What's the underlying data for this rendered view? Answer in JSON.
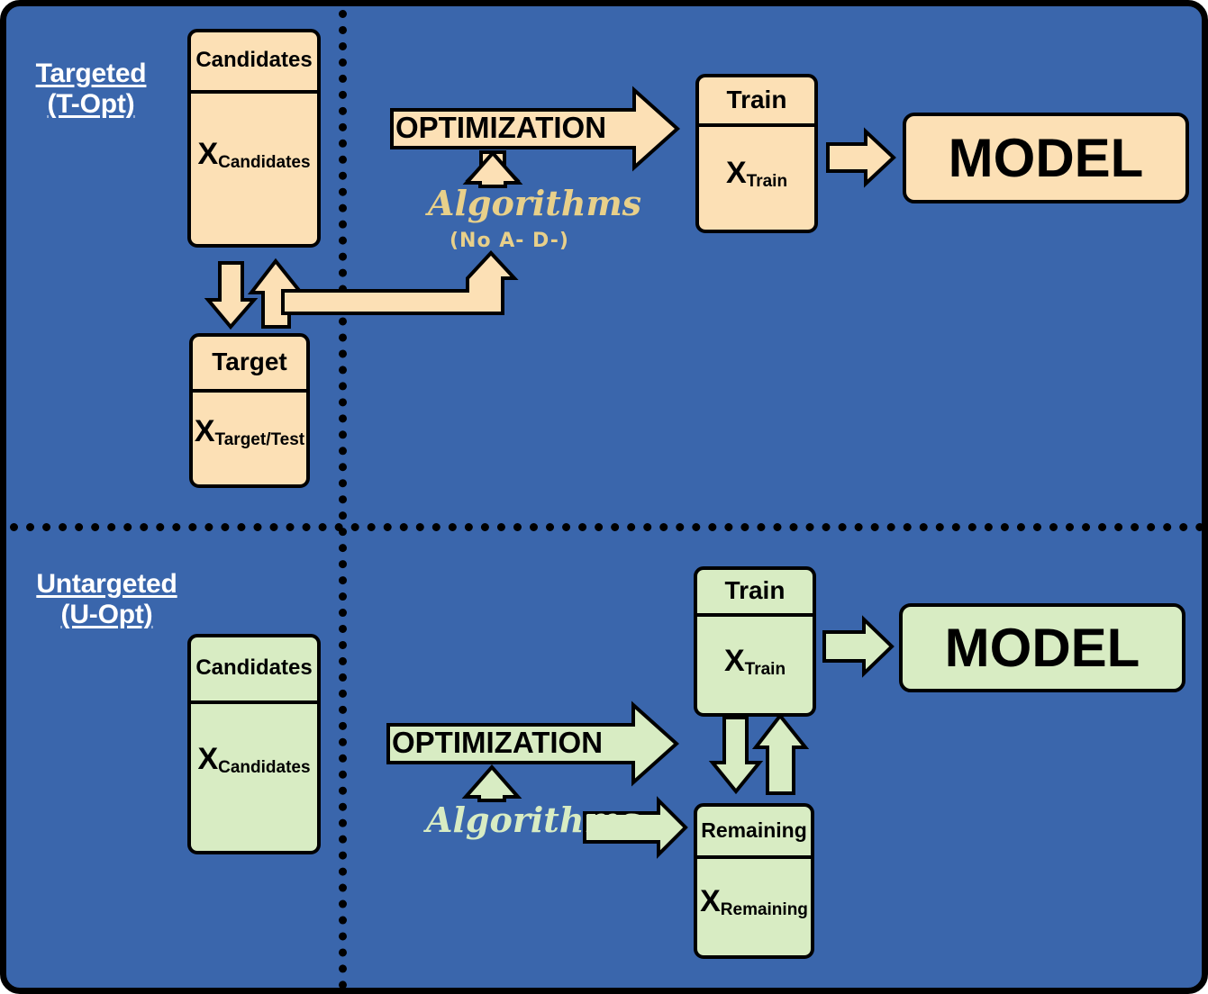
{
  "palette": {
    "background_blue": "#3A66AC",
    "tan": "#FCE0B5",
    "green": "#D8ECC3",
    "algorithms_tan_text": "#E8D08A",
    "algorithms_green_text": "#D8ECC3",
    "outline": "#000000",
    "label_white": "#FFFFFF"
  },
  "sections": {
    "targeted": {
      "name": "Targeted",
      "abbrev": "(T-Opt)",
      "boxes": {
        "candidates": {
          "header": "Candidates",
          "value_main": "X",
          "value_sub": "Candidates"
        },
        "target": {
          "header": "Target",
          "value_main": "X",
          "value_sub": "Target/Test"
        },
        "train": {
          "header": "Train",
          "value_main": "X",
          "value_sub": "Train"
        },
        "model": {
          "label": "MODEL"
        }
      },
      "optimization_label": "OPTIMIZATION",
      "algorithms_label": "Algorithms",
      "algorithms_note": "(No A- D-)"
    },
    "untargeted": {
      "name": "Untargeted",
      "abbrev": "(U-Opt)",
      "boxes": {
        "candidates": {
          "header": "Candidates",
          "value_main": "X",
          "value_sub": "Candidates"
        },
        "train": {
          "header": "Train",
          "value_main": "X",
          "value_sub": "Train"
        },
        "remaining": {
          "header": "Remaining",
          "value_main": "X",
          "value_sub": "Remaining"
        },
        "model": {
          "label": "MODEL"
        }
      },
      "optimization_label": "OPTIMIZATION",
      "algorithms_label": "Algorithms"
    }
  }
}
